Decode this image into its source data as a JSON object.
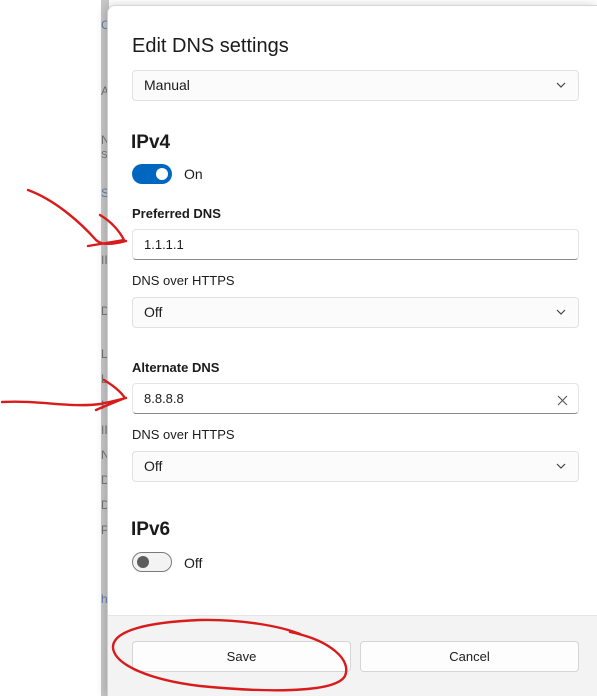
{
  "background": {
    "letters": [
      "C",
      "A",
      "N",
      "S",
      "S",
      "II",
      "D",
      "L",
      "L",
      "I",
      "II",
      "N",
      "D",
      "D",
      "P",
      "h"
    ]
  },
  "dialog": {
    "title": "Edit DNS settings",
    "mode_select": {
      "value": "Manual"
    },
    "ipv4": {
      "title": "IPv4",
      "toggle_state": "On",
      "preferred_dns": {
        "label": "Preferred DNS",
        "value": "1.1.1.1"
      },
      "preferred_doh": {
        "label": "DNS over HTTPS",
        "value": "Off"
      },
      "alternate_dns": {
        "label": "Alternate DNS",
        "value": "8.8.8.8"
      },
      "alternate_doh": {
        "label": "DNS over HTTPS",
        "value": "Off"
      }
    },
    "ipv6": {
      "title": "IPv6",
      "toggle_state": "Off"
    },
    "footer": {
      "save_label": "Save",
      "cancel_label": "Cancel"
    }
  },
  "colors": {
    "accent": "#0067c0",
    "annotation": "#d81b1b"
  },
  "icons": [
    "chevron-down-icon",
    "clear-icon"
  ]
}
